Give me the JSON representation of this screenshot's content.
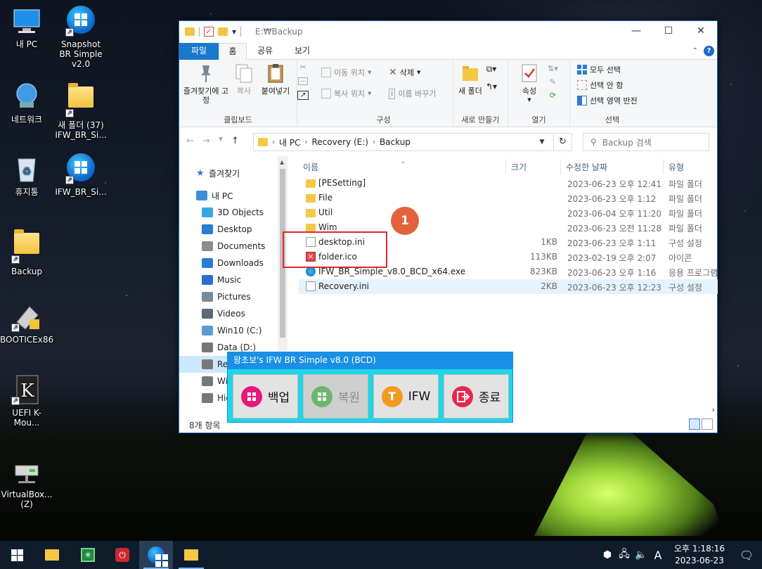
{
  "desktop": {
    "icons": [
      {
        "label": "내 PC",
        "glyph": "pc-icon"
      },
      {
        "label": "Snapshot BR Simple v2.0",
        "glyph": "shield-icon"
      },
      {
        "label": "네트워크",
        "glyph": "network-icon"
      },
      {
        "label": "새 폴더 (37) IFW_BR_Si...",
        "glyph": "folder-icon"
      },
      {
        "label": "휴지통",
        "glyph": "recycle-bin-icon"
      },
      {
        "label": "IFW_BR_Si...",
        "glyph": "shield-icon"
      },
      {
        "label": "Backup",
        "glyph": "folder-icon"
      },
      {
        "label": "BOOTICEx86",
        "glyph": "tool-icon"
      },
      {
        "label": "UEFI K-Mou...",
        "glyph": "k-icon"
      },
      {
        "label": "VirtualBox... (Z)",
        "glyph": "network-drive-icon"
      }
    ]
  },
  "explorer": {
    "title": "E:₩Backup",
    "tabs": {
      "file": "파일",
      "home": "홈",
      "share": "공유",
      "view": "보기"
    },
    "ribbon": {
      "clipboard": {
        "label": "클립보드",
        "pin": "즐겨찾기에 고정",
        "copy": "복사",
        "paste": "붙여넣기"
      },
      "organize": {
        "label": "구성",
        "move_to": "이동 위치",
        "copy_to": "복사 위치",
        "delete": "삭제",
        "rename": "이름 바꾸기"
      },
      "new": {
        "label": "새로 만들기",
        "new_folder": "새 폴더"
      },
      "open": {
        "label": "열기",
        "properties": "속성"
      },
      "select": {
        "label": "선택",
        "select_all": "모두 선택",
        "select_none": "선택 안 함",
        "invert": "선택 영역 반전"
      }
    },
    "address": {
      "crumbs": [
        "내 PC",
        "Recovery (E:)",
        "Backup"
      ],
      "search_placeholder": "Backup 검색"
    },
    "nav": [
      {
        "label": "즐겨찾기",
        "color": "#2a7fd6",
        "indent": 1
      },
      {
        "label": "내 PC",
        "color": "#3a8fd8",
        "indent": 1
      },
      {
        "label": "3D Objects",
        "color": "#38a8e0",
        "indent": 2
      },
      {
        "label": "Desktop",
        "color": "#2b7cd3",
        "indent": 2
      },
      {
        "label": "Documents",
        "color": "#8c8c8c",
        "indent": 2
      },
      {
        "label": "Downloads",
        "color": "#2b7cd3",
        "indent": 2
      },
      {
        "label": "Music",
        "color": "#2b6ec8",
        "indent": 2
      },
      {
        "label": "Pictures",
        "color": "#7a8a99",
        "indent": 2
      },
      {
        "label": "Videos",
        "color": "#5a6a7a",
        "indent": 2
      },
      {
        "label": "Win10 (C:)",
        "color": "#5b9bd5",
        "indent": 2
      },
      {
        "label": "Data (D:)",
        "color": "#777777",
        "indent": 2
      },
      {
        "label": "Recovery (E:)",
        "color": "#777777",
        "indent": 2,
        "selected": true
      },
      {
        "label": "Win",
        "color": "#777777",
        "indent": 2
      },
      {
        "label": "Hid",
        "color": "#777777",
        "indent": 2
      }
    ],
    "columns": {
      "name": "이름",
      "size": "크기",
      "date": "수정한 날짜",
      "type": "유형"
    },
    "files": [
      {
        "name": "[PESetting]",
        "size": "",
        "date": "2023-06-23 오후 12:41",
        "type": "파일 폴더",
        "icon": "folder"
      },
      {
        "name": "File",
        "size": "",
        "date": "2023-06-23 오후 1:12",
        "type": "파일 폴더",
        "icon": "folder"
      },
      {
        "name": "Util",
        "size": "",
        "date": "2023-06-04 오후 11:20",
        "type": "파일 폴더",
        "icon": "folder"
      },
      {
        "name": "Wim",
        "size": "",
        "date": "2023-06-23 오전 11:28",
        "type": "파일 폴더",
        "icon": "folder"
      },
      {
        "name": "desktop.ini",
        "size": "1KB",
        "date": "2023-06-23 오후 1:11",
        "type": "구성 설정",
        "icon": "ini"
      },
      {
        "name": "folder.ico",
        "size": "113KB",
        "date": "2023-02-19 오후 2:07",
        "type": "아이콘",
        "icon": "ico"
      },
      {
        "name": "IFW_BR_Simple_v8.0_BCD_x64.exe",
        "size": "823KB",
        "date": "2023-06-23 오후 1:16",
        "type": "응용 프로그램",
        "icon": "exe"
      },
      {
        "name": "Recovery.ini",
        "size": "2KB",
        "date": "2023-06-23 오후 12:23",
        "type": "구성 설정",
        "icon": "ini",
        "selected": true
      }
    ],
    "status": "8개 항목"
  },
  "annotation": {
    "badge": "1"
  },
  "tool": {
    "title": "왕초보's IFW BR Simple v8.0 (BCD)",
    "buttons": [
      {
        "label": "백업",
        "color": "#e5197a",
        "disabled": false,
        "glyph": "windows-logo-icon"
      },
      {
        "label": "복원",
        "color": "#4caf50",
        "disabled": true,
        "glyph": "windows-logo-icon"
      },
      {
        "label": "IFW",
        "color": "#f39a1e",
        "disabled": false,
        "glyph": "T"
      },
      {
        "label": "종료",
        "color": "#e8264b",
        "disabled": false,
        "glyph": "exit-icon"
      }
    ]
  },
  "taskbar": {
    "ime": "A",
    "time": "오후 1:18:16",
    "date": "2023-06-23"
  }
}
